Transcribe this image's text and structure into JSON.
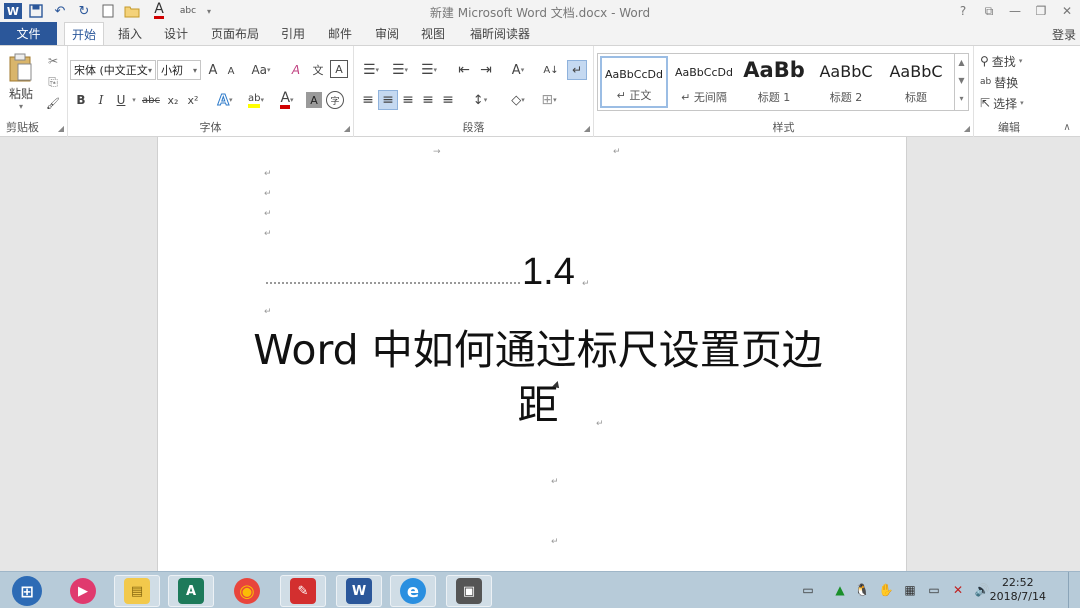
{
  "titlebar": {
    "title": "新建 Microsoft Word 文档.docx - Word",
    "qat": {
      "word": "W",
      "save": "💾",
      "undo": "↶",
      "redo": "↻",
      "font_color_label": "A",
      "spell": "abc"
    },
    "help": "?",
    "ribbon_options": "⧉",
    "minimize": "—",
    "restore": "❐",
    "close": "✕"
  },
  "tabs": {
    "file": "文件",
    "items": [
      "开始",
      "插入",
      "设计",
      "页面布局",
      "引用",
      "邮件",
      "审阅",
      "视图",
      "福昕阅读器"
    ],
    "active_index": 0,
    "login": "登录"
  },
  "ribbon": {
    "clipboard": {
      "label": "剪贴板",
      "paste": "粘贴",
      "paste_arrow": "▾",
      "cut": "✂",
      "copy": "⎘",
      "format_painter": "🖌"
    },
    "font": {
      "label": "字体",
      "font_name": "宋体 (中文正文)",
      "font_size": "小初",
      "grow": "A",
      "shrink": "A",
      "case": "Aa",
      "clear": "A",
      "phonetic": "文",
      "border_char": "A",
      "bold": "B",
      "italic": "I",
      "underline": "U",
      "strike": "abc",
      "subscript": "x₂",
      "superscript": "x²",
      "effects": "A",
      "highlight": "ab",
      "font_color": "A",
      "shading": "A",
      "enclose": "字"
    },
    "paragraph": {
      "label": "段落",
      "bullets": "☰",
      "numbering": "☰",
      "multilevel": "☰",
      "decrease_indent": "⇤",
      "increase_indent": "⇥",
      "chinese_layout": "A",
      "sort": "A↓",
      "show_marks": "↵",
      "align_left": "≡",
      "align_center": "≡",
      "align_right": "≡",
      "justify": "≡",
      "distributed": "≡",
      "line_spacing": "↕",
      "shading": "◇",
      "borders": "⊞"
    },
    "styles": {
      "label": "样式",
      "items": [
        {
          "preview": "AaBbCcDd",
          "name": "↵ 正文"
        },
        {
          "preview": "AaBbCcDd",
          "name": "↵ 无间隔"
        },
        {
          "preview": "AaBb",
          "name": "标题 1"
        },
        {
          "preview": "AaBbC",
          "name": "标题 2"
        },
        {
          "preview": "AaBbC",
          "name": "标题"
        }
      ],
      "selected_index": 0
    },
    "editing": {
      "label": "编辑",
      "find": "查找",
      "replace": "替换",
      "select": "选择"
    },
    "collapse": "∧"
  },
  "document": {
    "number": "1.4",
    "heading": "Word 中如何通过标尺设置页边距",
    "para_mark": "↵",
    "tab_mark": "→"
  },
  "taskbar": {
    "start": "⊞",
    "apps": [
      {
        "name": "media-player",
        "glyph": "▶"
      },
      {
        "name": "file-explorer",
        "glyph": "▤"
      },
      {
        "name": "publisher",
        "glyph": "A"
      },
      {
        "name": "chrome",
        "glyph": "◉"
      },
      {
        "name": "foxit-reader",
        "glyph": "✎"
      },
      {
        "name": "word",
        "glyph": "W"
      },
      {
        "name": "internet-explorer",
        "glyph": "e"
      },
      {
        "name": "screen-recorder",
        "glyph": "▣"
      }
    ],
    "tray": [
      "▭",
      "▲",
      "🐧",
      "✋",
      "▦",
      "▭",
      "✕",
      "🔊"
    ],
    "time": "22:52",
    "date": "2018/7/14"
  },
  "colors": {
    "accent": "#2b579a",
    "taskbar": "#b7cbd9",
    "font_color_red": "#d00000",
    "highlight_yellow": "#ffff00"
  }
}
